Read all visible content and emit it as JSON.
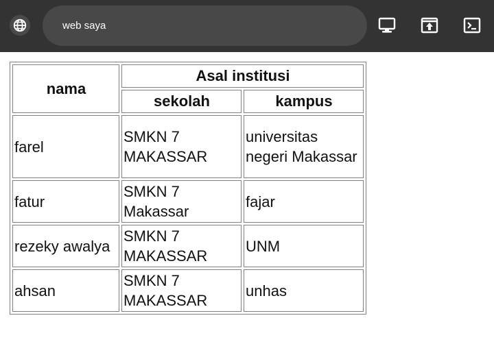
{
  "browser": {
    "globe_icon": "globe-icon",
    "url_text": "web saya",
    "icons": [
      "desktop-icon",
      "open-in-new-icon",
      "terminal-icon"
    ]
  },
  "table": {
    "header_nama": "nama",
    "header_group": "Asal institusi",
    "header_sekolah": "sekolah",
    "header_kampus": "kampus",
    "rows": [
      {
        "nama": "farel",
        "sekolah": "SMKN 7 MAKASSAR",
        "kampus": "universitas negeri Makassar"
      },
      {
        "nama": "fatur",
        "sekolah": "SMKN 7 Makassar",
        "kampus": "fajar"
      },
      {
        "nama": "rezeky awalya",
        "sekolah": "SMKN 7 MAKASSAR",
        "kampus": "UNM"
      },
      {
        "nama": "ahsan",
        "sekolah": "SMKN 7 MAKASSAR",
        "kampus": "unhas"
      }
    ]
  }
}
